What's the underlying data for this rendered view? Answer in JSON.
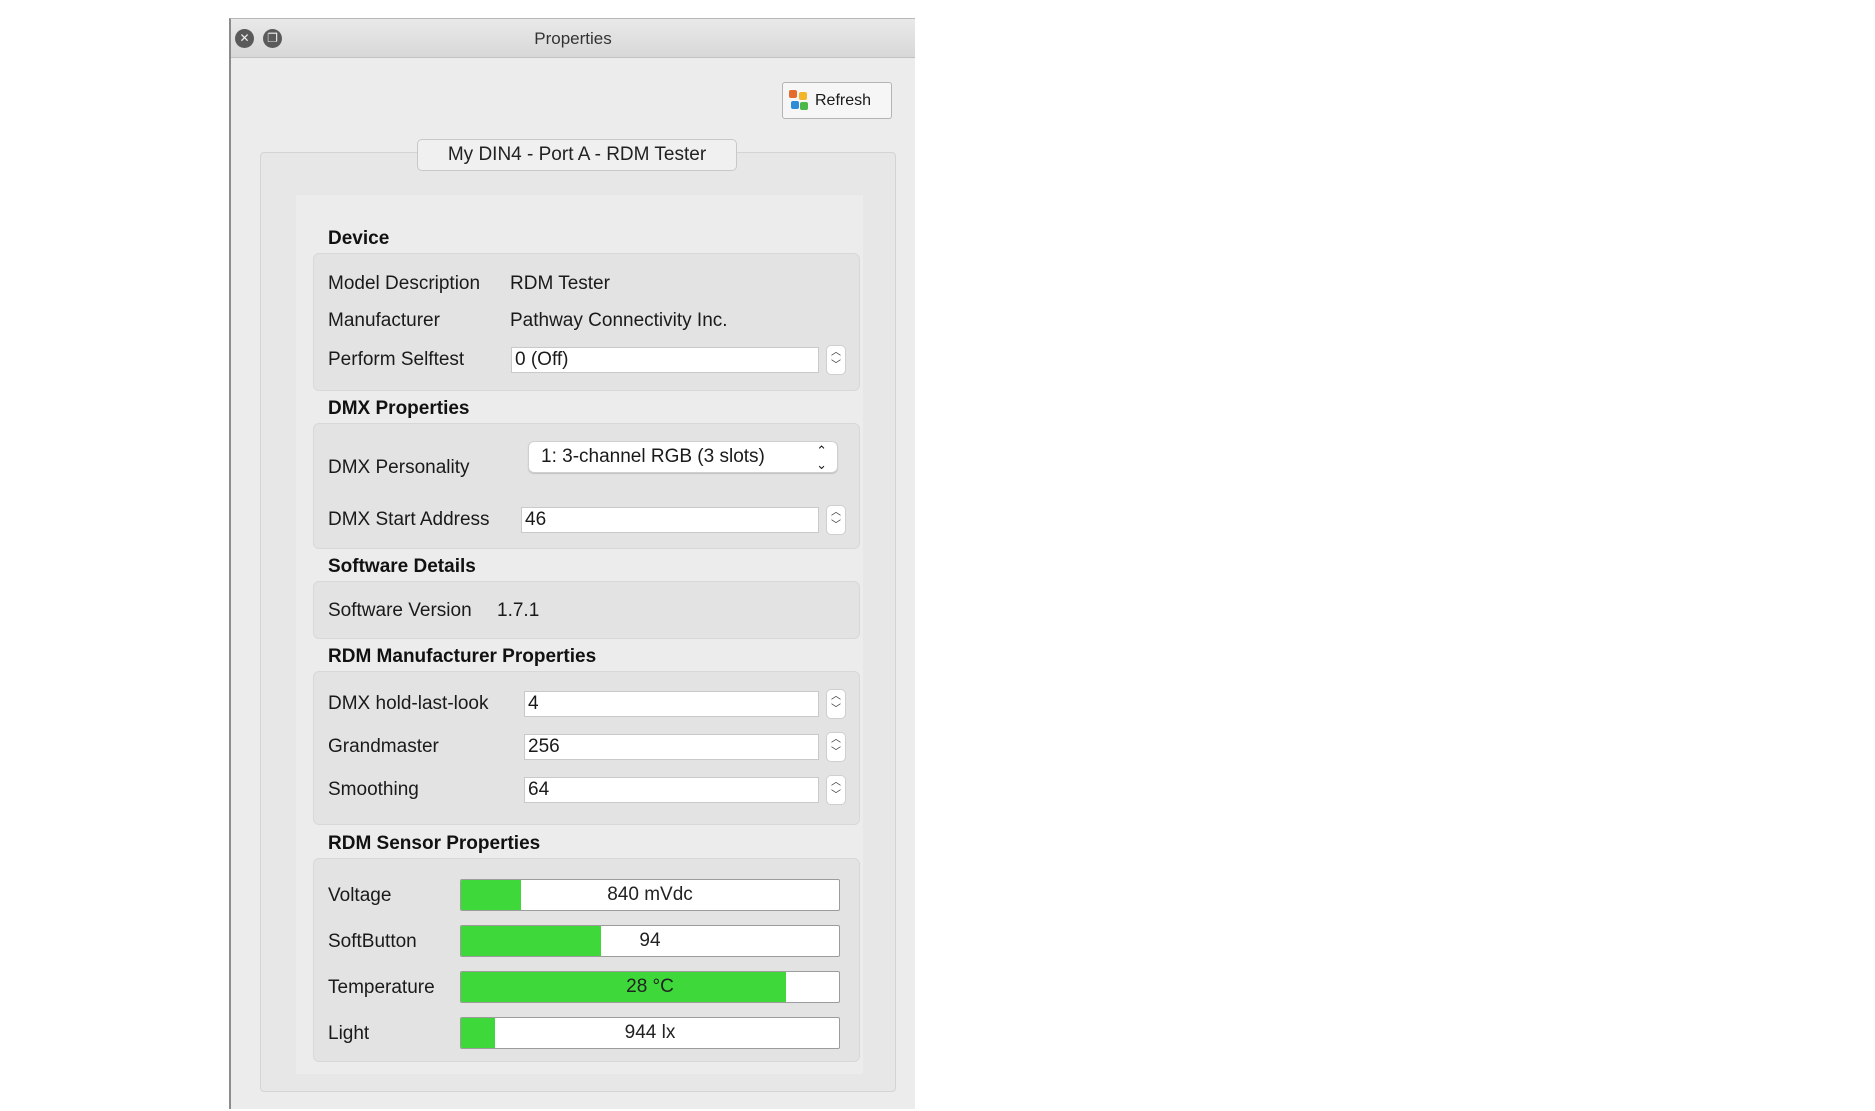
{
  "window": {
    "title": "Properties"
  },
  "toolbar": {
    "refresh_label": "Refresh"
  },
  "tab": {
    "title": "My DIN4 - Port A - RDM Tester"
  },
  "device": {
    "heading": "Device",
    "model_label": "Model Description",
    "model_value": "RDM Tester",
    "manufacturer_label": "Manufacturer",
    "manufacturer_value": "Pathway Connectivity Inc.",
    "selftest_label": "Perform Selftest",
    "selftest_value": "0 (Off)"
  },
  "dmx": {
    "heading": "DMX Properties",
    "personality_label": "DMX Personality",
    "personality_value": "1: 3-channel RGB (3 slots)",
    "start_label": "DMX Start Address",
    "start_value": "46"
  },
  "software": {
    "heading": "Software Details",
    "version_label": "Software Version",
    "version_value": "1.7.1"
  },
  "manufacturer_props": {
    "heading": "RDM Manufacturer Properties",
    "hold_label": "DMX hold-last-look",
    "hold_value": "4",
    "grandmaster_label": "Grandmaster",
    "grandmaster_value": "256",
    "smoothing_label": "Smoothing",
    "smoothing_value": "64"
  },
  "sensors": {
    "heading": "RDM Sensor Properties",
    "fill_color": "#3ed83a",
    "items": [
      {
        "label": "Voltage",
        "value": "840 mVdc",
        "level": 0.16
      },
      {
        "label": "SoftButton",
        "value": "94",
        "level": 0.37
      },
      {
        "label": "Temperature",
        "value": "28 °C",
        "level": 0.86
      },
      {
        "label": "Light",
        "value": "944 lx",
        "level": 0.09
      }
    ]
  },
  "icons": {
    "close": "close-icon",
    "restore": "restore-icon",
    "refresh": "refresh-icon"
  }
}
